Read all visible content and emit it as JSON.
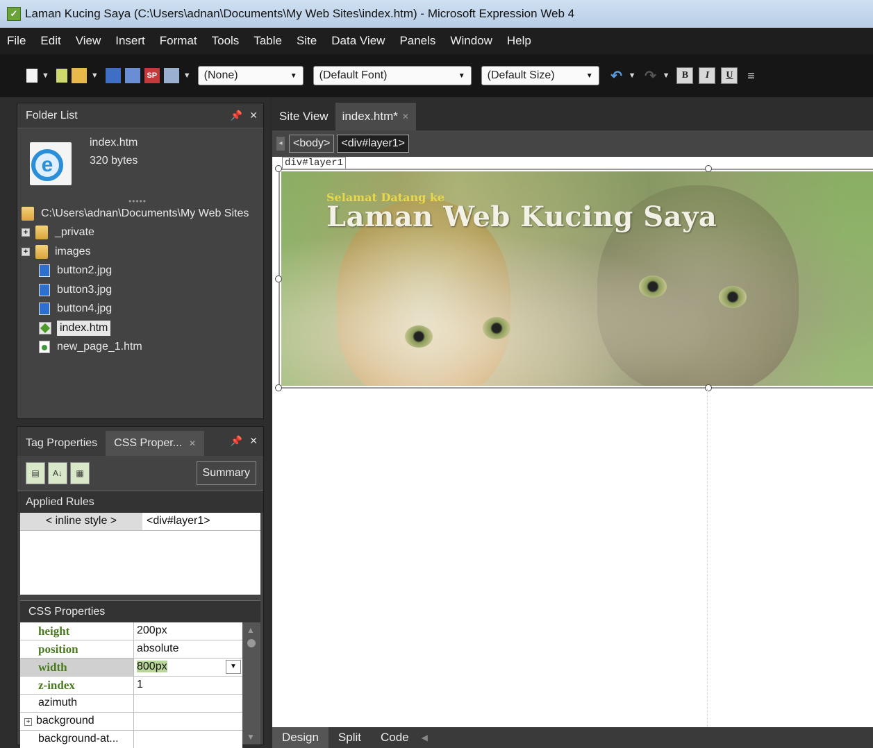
{
  "window": {
    "title": "Laman Kucing Saya (C:\\Users\\adnan\\Documents\\My Web Sites\\index.htm) - Microsoft Expression Web 4"
  },
  "menu": [
    "File",
    "Edit",
    "View",
    "Insert",
    "Format",
    "Tools",
    "Table",
    "Site",
    "Data View",
    "Panels",
    "Window",
    "Help"
  ],
  "toolbar": {
    "style_select": "(None)",
    "font_select": "(Default Font)",
    "size_select": "(Default Size)",
    "sp_icon_label": "SP",
    "bold": "B",
    "italic": "I",
    "underline": "U"
  },
  "folder_list": {
    "title": "Folder List",
    "selected_file": {
      "name": "index.htm",
      "size": "320 bytes"
    },
    "root": "C:\\Users\\adnan\\Documents\\My Web Sites",
    "items": [
      {
        "label": "_private",
        "type": "folder"
      },
      {
        "label": "images",
        "type": "folder"
      },
      {
        "label": "button2.jpg",
        "type": "jpg"
      },
      {
        "label": "button3.jpg",
        "type": "jpg"
      },
      {
        "label": "button4.jpg",
        "type": "jpg"
      },
      {
        "label": "index.htm",
        "type": "htm"
      },
      {
        "label": "new_page_1.htm",
        "type": "new"
      }
    ]
  },
  "css_panel": {
    "tabs": [
      "Tag Properties",
      "CSS Proper..."
    ],
    "summary_label": "Summary",
    "applied_rules_label": "Applied Rules",
    "rule": {
      "selector": "< inline style >",
      "element": "<div#layer1>"
    },
    "css_properties_label": "CSS Properties",
    "properties": [
      {
        "name": "height",
        "value": "200px"
      },
      {
        "name": "position",
        "value": "absolute"
      },
      {
        "name": "width",
        "value": "800px"
      },
      {
        "name": "z-index",
        "value": "1"
      },
      {
        "name": "azimuth",
        "value": ""
      },
      {
        "name": "background",
        "value": ""
      },
      {
        "name": "background-at...",
        "value": ""
      }
    ]
  },
  "editor": {
    "tabs": [
      "Site View",
      "index.htm*"
    ],
    "tag_crumbs": [
      "<body>",
      "<div#layer1>"
    ],
    "layer_label": "div#layer1",
    "banner_subtitle": "Selamat Datang ke",
    "banner_title": "Laman Web Kucing Saya",
    "view_tabs": [
      "Design",
      "Split",
      "Code"
    ]
  }
}
